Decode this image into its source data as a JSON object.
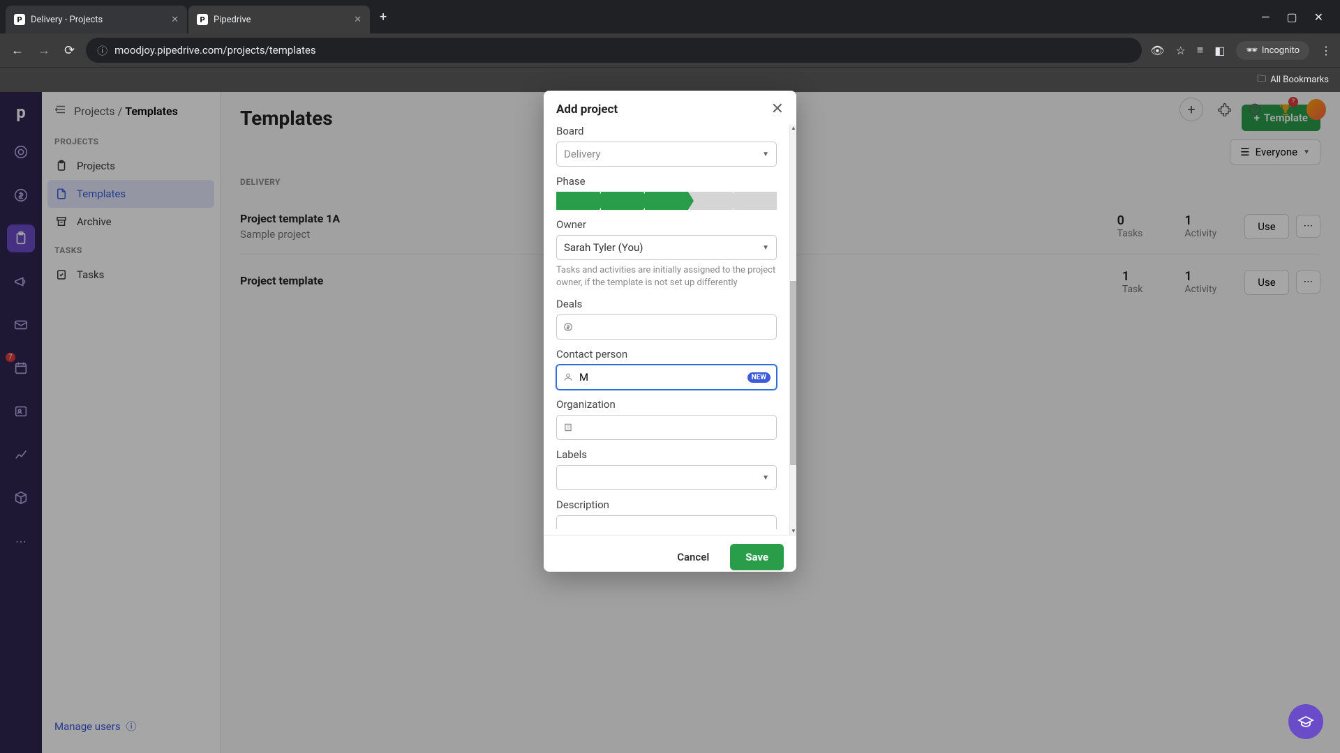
{
  "browser": {
    "tabs": [
      {
        "title": "Delivery - Projects"
      },
      {
        "title": "Pipedrive"
      }
    ],
    "url": "moodjoy.pipedrive.com/projects/templates",
    "incognito_label": "Incognito",
    "all_bookmarks": "All Bookmarks"
  },
  "breadcrumb": {
    "root": "Projects",
    "current": "Templates"
  },
  "sidebar": {
    "section_projects": "PROJECTS",
    "section_tasks": "TASKS",
    "items_projects": [
      {
        "label": "Projects"
      },
      {
        "label": "Templates"
      },
      {
        "label": "Archive"
      }
    ],
    "items_tasks": [
      {
        "label": "Tasks"
      }
    ],
    "manage_users": "Manage users",
    "notification_badge": "7"
  },
  "page": {
    "title": "Templates",
    "template_button": "Template",
    "filter_label": "Everyone",
    "section_label": "DELIVERY",
    "rows": [
      {
        "title": "Project template 1A",
        "subtitle": "Sample project",
        "stat1_num": "0",
        "stat1_label": "Tasks",
        "stat2_num": "1",
        "stat2_label": "Activity",
        "use_label": "Use"
      },
      {
        "title": "Project template",
        "subtitle": "",
        "stat1_num": "1",
        "stat1_label": "Task",
        "stat2_num": "1",
        "stat2_label": "Activity",
        "use_label": "Use"
      }
    ]
  },
  "modal": {
    "title": "Add project",
    "board_label": "Board",
    "board_value": "Delivery",
    "phase_label": "Phase",
    "owner_label": "Owner",
    "owner_value": "Sarah Tyler (You)",
    "owner_hint": "Tasks and activities are initially assigned to the project owner, if the template is not set up differently",
    "deals_label": "Deals",
    "contact_label": "Contact person",
    "contact_value": "M",
    "contact_badge": "NEW",
    "org_label": "Organization",
    "labels_label": "Labels",
    "description_label": "Description",
    "cancel_label": "Cancel",
    "save_label": "Save"
  },
  "gift_badge": "?"
}
